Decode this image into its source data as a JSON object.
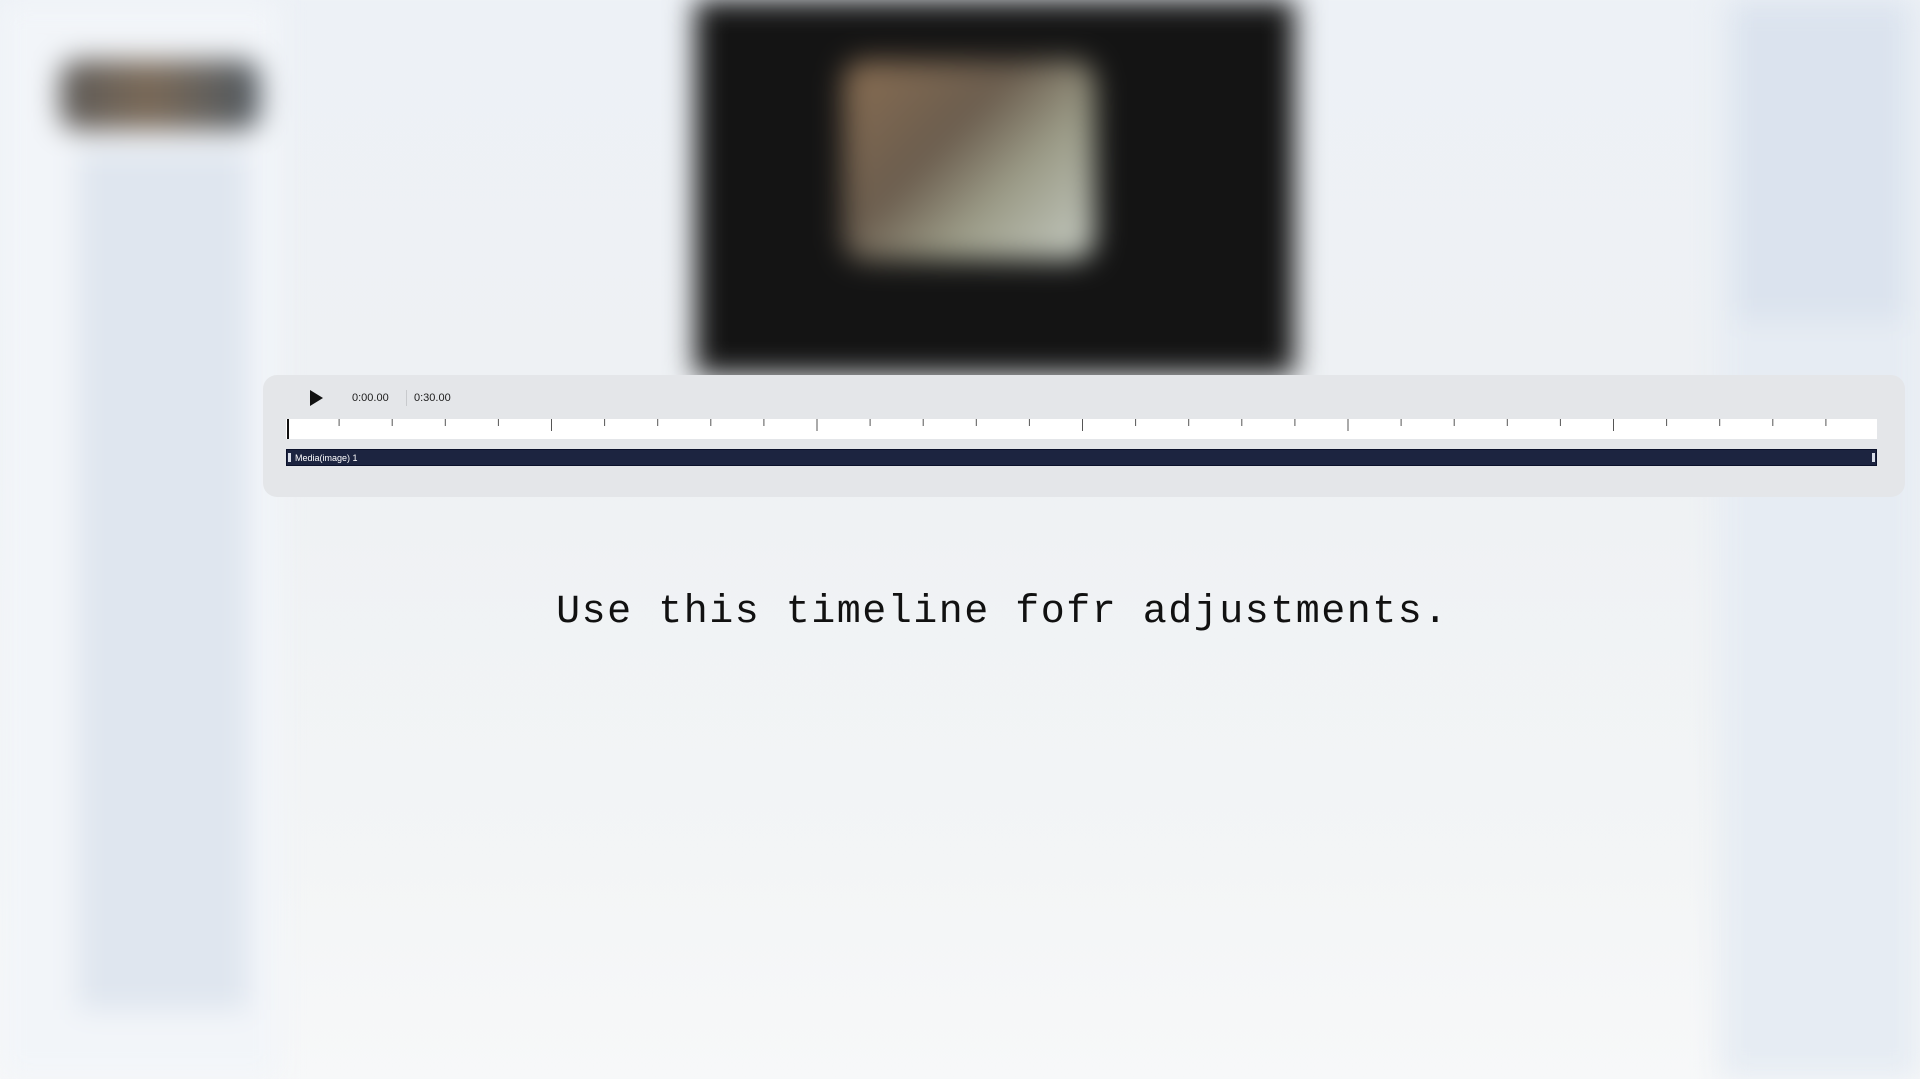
{
  "timeline": {
    "play_label": "Play",
    "current_time": "0:00.00",
    "total_time": "0:30.00",
    "track": {
      "label": "Media(image) 1"
    }
  },
  "caption": "Use this timeline fofr adjustments.",
  "colors": {
    "track": "#1c2440",
    "timeline_bg": "#e4e6e9",
    "ruler_bg": "#ffffff",
    "preview_bg": "#141414"
  },
  "icons": {
    "play": "play-icon"
  }
}
